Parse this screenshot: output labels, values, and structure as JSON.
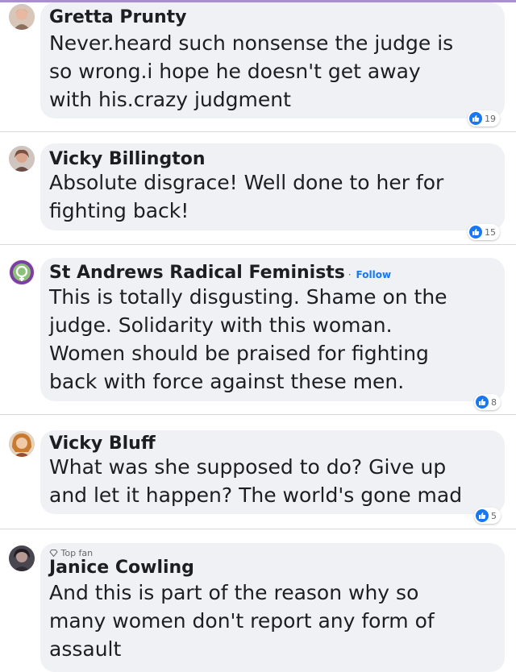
{
  "comments": [
    {
      "author": "Gretta Prunty",
      "lines": [
        "Never.heard such nonsense the judge is",
        "so wrong.i hope he doesn't get away",
        "with his.crazy judgment"
      ],
      "likes": "19",
      "avatar_color": "#d8b49a"
    },
    {
      "author": "Vicky Billington",
      "lines": [
        "Absolute disgrace! Well done to her for",
        "fighting back!"
      ],
      "likes": "15",
      "avatar_color": "#b98c7d"
    },
    {
      "author": "St Andrews Radical Feminists",
      "follow": "Follow",
      "lines": [
        "This is totally disgusting. Shame on the",
        "judge. Solidarity with this woman.",
        "Women should be praised for fighting",
        "back with force against these men."
      ],
      "likes": "8",
      "avatar_color": "#7a3fa0"
    },
    {
      "author": "Vicky Bluff",
      "lines": [
        "What was she supposed to do? Give up",
        "and let it happen? The world's gone mad"
      ],
      "likes": "5",
      "avatar_color": "#c98a4a"
    },
    {
      "badge": "Top fan",
      "author": "Janice Cowling",
      "lines": [
        "And this is part of the reason why so",
        "many women don't report any form of",
        "assault"
      ],
      "avatar_color": "#5a5560"
    }
  ],
  "colors": {
    "bubble": "#eff1f4",
    "like_blue": "#1877f2",
    "accent_top": "#a98fd0"
  }
}
